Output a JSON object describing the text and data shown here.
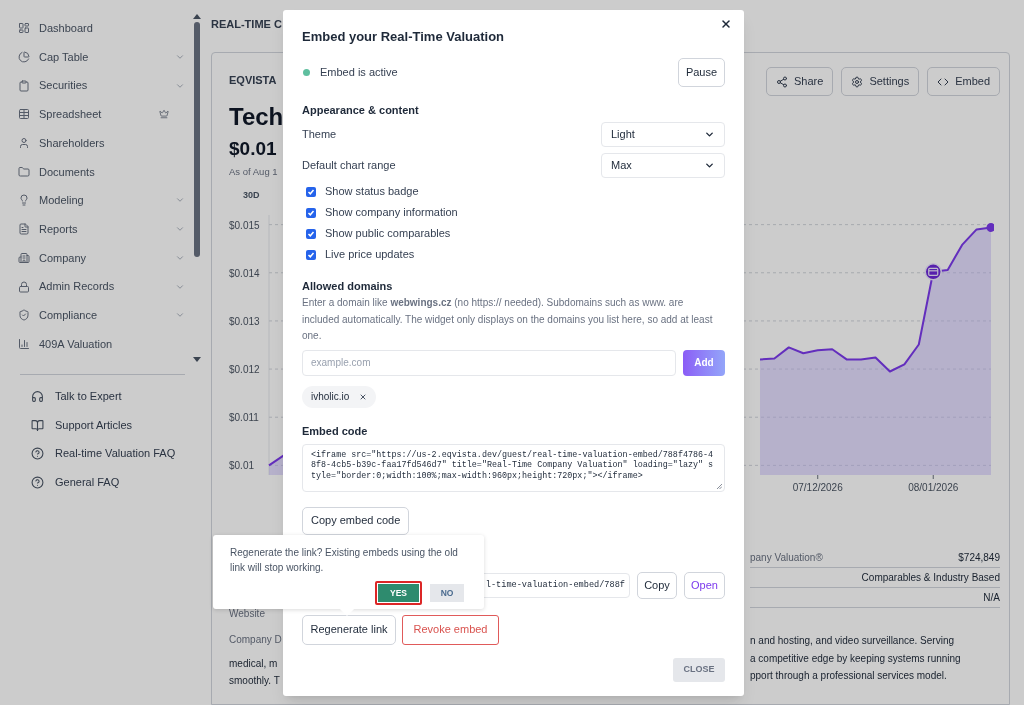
{
  "sidebar": {
    "nav_items": [
      {
        "label": "Dashboard",
        "expandable": false,
        "premium": false
      },
      {
        "label": "Cap Table",
        "expandable": true,
        "premium": false
      },
      {
        "label": "Securities",
        "expandable": true,
        "premium": false
      },
      {
        "label": "Spreadsheet",
        "expandable": false,
        "premium": true
      },
      {
        "label": "Shareholders",
        "expandable": false,
        "premium": false
      },
      {
        "label": "Documents",
        "expandable": false,
        "premium": false
      },
      {
        "label": "Modeling",
        "expandable": true,
        "premium": false
      },
      {
        "label": "Reports",
        "expandable": true,
        "premium": false
      },
      {
        "label": "Company",
        "expandable": true,
        "premium": false
      },
      {
        "label": "Admin Records",
        "expandable": true,
        "premium": false
      },
      {
        "label": "Compliance",
        "expandable": true,
        "premium": false
      },
      {
        "label": "409A Valuation",
        "expandable": false,
        "premium": false
      }
    ],
    "help_links": [
      "Talk to Expert",
      "Support Articles",
      "Real-time Valuation FAQ",
      "General FAQ"
    ]
  },
  "page": {
    "heading": "REAL-TIME C",
    "card": {
      "company_label": "EQVISTA",
      "name": "Tech",
      "price": "$0.01",
      "as_of": "As of Aug 1",
      "range_button": "30D",
      "actions": [
        "Share",
        "Settings",
        "Embed"
      ],
      "chart_data": {
        "type": "area",
        "categories": [
          null,
          null,
          null,
          null,
          null,
          null,
          null,
          null,
          null,
          null,
          null,
          null,
          null,
          null,
          null,
          null,
          null,
          null,
          null,
          null,
          null,
          null,
          null,
          null,
          null,
          null,
          null,
          null,
          null,
          null,
          null,
          null,
          null,
          null,
          null,
          null,
          null,
          null,
          "07/12/2026",
          null,
          null,
          null,
          null,
          null,
          null,
          null,
          "08/01/2026",
          null,
          null,
          null,
          null
        ],
        "values": [
          0.01,
          0.0102,
          null,
          null,
          null,
          null,
          null,
          null,
          null,
          null,
          null,
          null,
          null,
          null,
          null,
          null,
          null,
          null,
          null,
          null,
          null,
          null,
          null,
          null,
          null,
          null,
          null,
          null,
          null,
          null,
          null,
          null,
          null,
          null,
          0.0122,
          0.01222,
          0.01245,
          0.01233,
          0.01239,
          0.01241,
          0.0122,
          0.0122,
          0.01224,
          0.01195,
          0.0121,
          0.01251,
          0.01402,
          0.01406,
          0.01458,
          0.0149,
          0.01494
        ],
        "ylim": [
          0.0098,
          0.0152
        ],
        "grid": true,
        "yticks": [
          {
            "value": 0.015,
            "label": "$0.015"
          },
          {
            "value": 0.014,
            "label": "$0.014"
          },
          {
            "value": 0.013,
            "label": "$0.013"
          },
          {
            "value": 0.012,
            "label": "$0.012"
          },
          {
            "value": 0.011,
            "label": "$0.011"
          },
          {
            "value": 0.01,
            "label": "$0.01"
          }
        ]
      },
      "details": [
        {
          "label": "pany Valuation®",
          "value": "$724,849"
        },
        {
          "value": "Comparables & Industry Based"
        },
        {
          "value": "N/A"
        }
      ],
      "website_label": "Website",
      "description_label": "Company D",
      "description_left": [
        "medical, m",
        "smoothly. T"
      ],
      "description_right": [
        "n and hosting, and video surveillance. Serving",
        "a competitive edge by keeping systems running",
        "pport through a professional services model."
      ]
    }
  },
  "modal": {
    "title": "Embed your Real-Time Valuation",
    "status": {
      "label": "Embed is active",
      "active": true
    },
    "pause_button": "Pause",
    "appearance": {
      "heading": "Appearance & content",
      "selects": [
        {
          "label": "Theme",
          "value": "Light"
        },
        {
          "label": "Default chart range",
          "value": "Max"
        }
      ],
      "options": [
        {
          "label": "Show status badge",
          "checked": true
        },
        {
          "label": "Show company information",
          "checked": true
        },
        {
          "label": "Show public comparables",
          "checked": true
        },
        {
          "label": "Live price updates",
          "checked": true
        }
      ]
    },
    "domains": {
      "heading": "Allowed domains",
      "help": "Enter a domain like **webwings.cz** (no https:// needed). Subdomains such as www. are included automatically. The widget only displays on the domains you list here, so add at least one.",
      "placeholder": "example.com",
      "add_button": "Add",
      "chips": [
        "ivholic.io"
      ]
    },
    "embed_code": {
      "heading": "Embed code",
      "code": "<iframe src=\"https://us-2.eqvista.dev/guest/real-time-valuation-embed/788f4786-48f8-4cb5-b39c-faa17fd546d7\" title=\"Real-Time Company Valuation\" loading=\"lazy\" style=\"border:0;width:100%;max-width:960px;height:720px;\"></iframe>",
      "copy_button": "Copy embed code"
    },
    "link": {
      "value": "l-time-valuation-embed/788f",
      "copy_button": "Copy",
      "open_button": "Open"
    },
    "actions": {
      "regenerate": "Regenerate link",
      "revoke": "Revoke embed"
    },
    "close_button": "CLOSE"
  },
  "popover": {
    "message": "Regenerate the link? Existing embeds using the old link will stop working.",
    "buttons": [
      {
        "label": "YES",
        "kind": "confirm",
        "highlighted": true
      },
      {
        "label": "NO",
        "kind": "cancel",
        "highlighted": false
      }
    ]
  }
}
